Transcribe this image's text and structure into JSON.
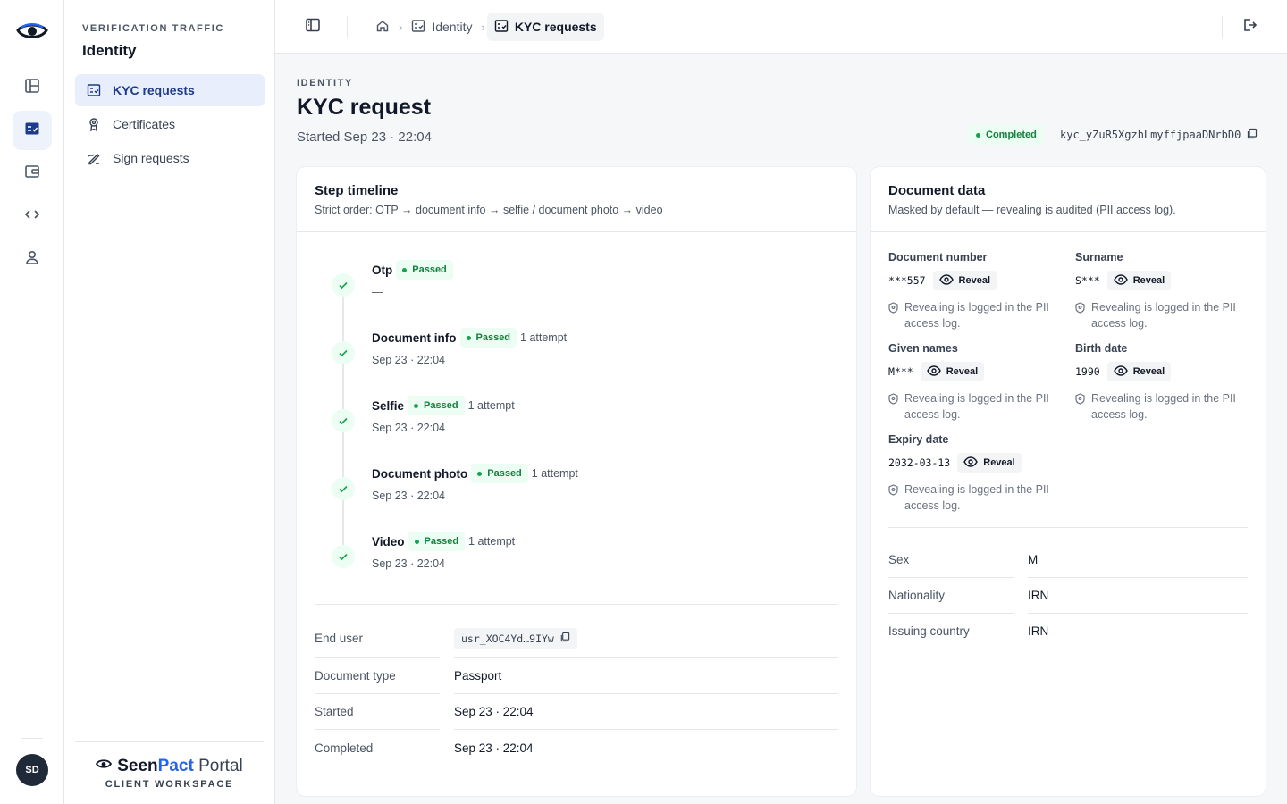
{
  "rail": {
    "items": [
      {
        "icon": "layout-panel-icon",
        "active": false
      },
      {
        "icon": "checklist-icon",
        "active": true
      },
      {
        "icon": "wallet-icon",
        "active": false
      },
      {
        "icon": "code-icon",
        "active": false
      },
      {
        "icon": "user-icon",
        "active": false
      }
    ],
    "avatar_initials": "SD"
  },
  "subnav": {
    "eyebrow": "VERIFICATION TRAFFIC",
    "title": "Identity",
    "items": [
      {
        "label": "KYC requests",
        "active": true
      },
      {
        "label": "Certificates",
        "active": false
      },
      {
        "label": "Sign requests",
        "active": false
      }
    ]
  },
  "brand": {
    "seen": "Seen",
    "pact": "Pact",
    "portal": "Portal",
    "subtitle": "CLIENT WORKSPACE"
  },
  "topbar": {
    "breadcrumb": [
      {
        "label": "Identity"
      },
      {
        "label": "KYC requests"
      }
    ]
  },
  "header": {
    "eyebrow": "IDENTITY",
    "title": "KYC request",
    "subtitle": "Started Sep 23 · 22:04",
    "status": "Completed",
    "request_id": "kyc_yZuR5XgzhLmyffjpaaDNrbD0"
  },
  "timeline": {
    "title": "Step timeline",
    "subtitle": "Strict order: OTP → document info → selfie / document photo → video",
    "steps": [
      {
        "name": "Otp",
        "status": "Passed",
        "attempts": "",
        "time": "—"
      },
      {
        "name": "Document info",
        "status": "Passed",
        "attempts": "1 attempt",
        "time": "Sep 23 · 22:04"
      },
      {
        "name": "Selfie",
        "status": "Passed",
        "attempts": "1 attempt",
        "time": "Sep 23 · 22:04"
      },
      {
        "name": "Document photo",
        "status": "Passed",
        "attempts": "1 attempt",
        "time": "Sep 23 · 22:04"
      },
      {
        "name": "Video",
        "status": "Passed",
        "attempts": "1 attempt",
        "time": "Sep 23 · 22:04"
      }
    ],
    "details": [
      {
        "key": "End user",
        "value": "usr_XOC4Yd…9IYw",
        "chip": true
      },
      {
        "key": "Document type",
        "value": "Passport",
        "chip": false
      },
      {
        "key": "Started",
        "value": "Sep 23 · 22:04",
        "chip": false
      },
      {
        "key": "Completed",
        "value": "Sep 23 · 22:04",
        "chip": false
      }
    ]
  },
  "document": {
    "title": "Document data",
    "subtitle": "Masked by default — revealing is audited (PII access log).",
    "reveal_label": "Reveal",
    "audit_note": "Revealing is logged in the PII access log.",
    "fields": [
      {
        "label": "Document number",
        "value": "***557"
      },
      {
        "label": "Surname",
        "value": "S***"
      },
      {
        "label": "Given names",
        "value": "M***"
      },
      {
        "label": "Birth date",
        "value": "1990"
      },
      {
        "label": "Expiry date",
        "value": "2032-03-13"
      }
    ],
    "attributes": [
      {
        "key": "Sex",
        "value": "M"
      },
      {
        "key": "Nationality",
        "value": "IRN"
      },
      {
        "key": "Issuing country",
        "value": "IRN"
      }
    ]
  },
  "colors": {
    "accent": "#1e3a8a",
    "success": "#16a34a",
    "success_bg": "#ecfdf3",
    "brand_blue": "#2563eb"
  }
}
